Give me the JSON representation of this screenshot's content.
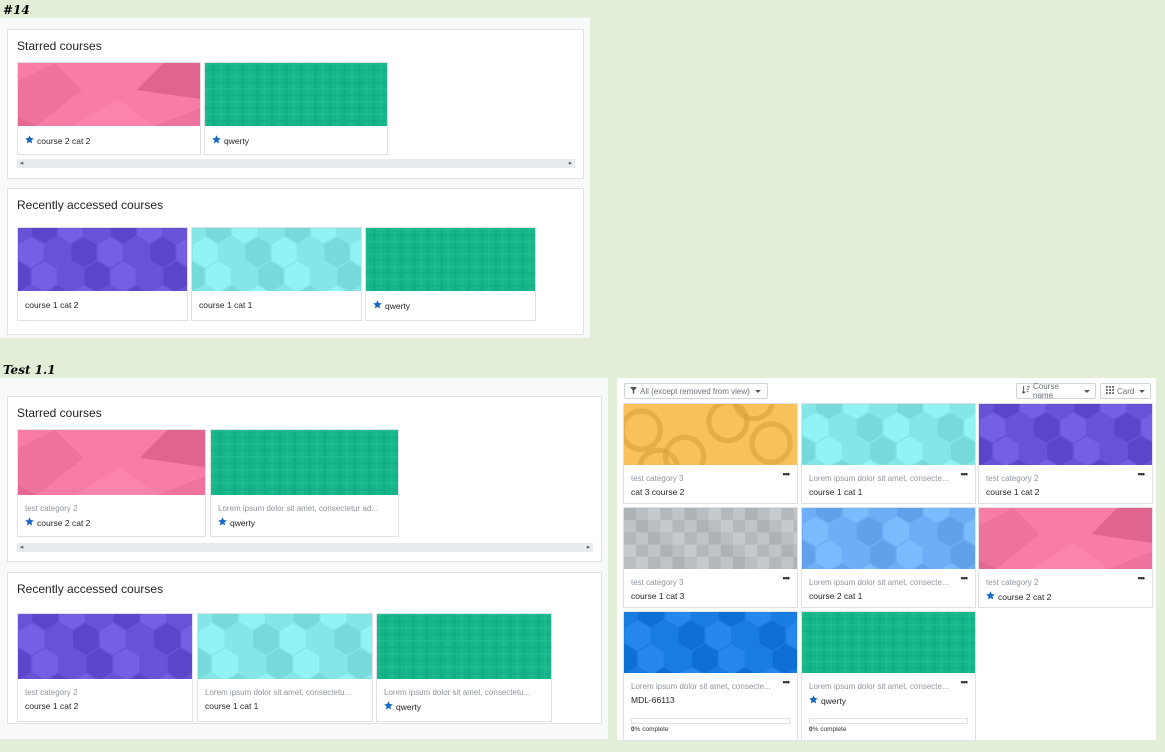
{
  "labels": {
    "section1": "#14",
    "section2": "Test 1.1"
  },
  "colors": {
    "pink": "#f77ca8",
    "green": "#17b58a",
    "purple": "#6a52d6",
    "teal": "#84e6e6",
    "orange": "#f8c15a",
    "grey": "#b8bec2",
    "blue": "#6daef6",
    "darkblue": "#1a7ce0",
    "star": "#1769c3"
  },
  "s14": {
    "starred": {
      "title": "Starred courses",
      "cards": [
        {
          "name": "course 2 cat 2",
          "starred": true,
          "pattern": "pink"
        },
        {
          "name": "qwerty",
          "starred": true,
          "pattern": "green"
        }
      ]
    },
    "recent": {
      "title": "Recently accessed courses",
      "cards": [
        {
          "name": "course 1 cat 2",
          "starred": false,
          "pattern": "purple"
        },
        {
          "name": "course 1 cat 1",
          "starred": false,
          "pattern": "teal"
        },
        {
          "name": "qwerty",
          "starred": true,
          "pattern": "green"
        }
      ]
    }
  },
  "t11": {
    "starred": {
      "title": "Starred courses",
      "cards": [
        {
          "category": "test category 2",
          "name": "course 2 cat 2",
          "starred": true,
          "pattern": "pink"
        },
        {
          "category": "Lorem ipsum dolor sit amet, consectetur ad...",
          "name": "qwerty",
          "starred": true,
          "pattern": "green"
        }
      ]
    },
    "recent": {
      "title": "Recently accessed courses",
      "cards": [
        {
          "category": "test category 2",
          "name": "course 1 cat 2",
          "starred": false,
          "pattern": "purple"
        },
        {
          "category": "Lorem ipsum dolor sit amet, consectetu...",
          "name": "course 1 cat 1",
          "starred": false,
          "pattern": "teal"
        },
        {
          "category": "Lorem ipsum dolor sit amet, consectetu...",
          "name": "qwerty",
          "starred": true,
          "pattern": "green"
        }
      ]
    }
  },
  "overview": {
    "filter_label": "All (except removed from view)",
    "sort_label": "Course name",
    "view_label": "Card",
    "cards": [
      {
        "category": "test category 3",
        "name": "cat 3 course 2",
        "starred": false,
        "pattern": "orange"
      },
      {
        "category": "Lorem ipsum dolor sit amet, consecte...",
        "name": "course 1 cat 1",
        "starred": false,
        "pattern": "teal"
      },
      {
        "category": "test category 2",
        "name": "course 1 cat 2",
        "starred": false,
        "pattern": "purple"
      },
      {
        "category": "test category 3",
        "name": "course 1 cat 3",
        "starred": false,
        "pattern": "grey"
      },
      {
        "category": "Lorem ipsum dolor sit amet, consecte...",
        "name": "course 2 cat 1",
        "starred": false,
        "pattern": "blue"
      },
      {
        "category": "test category 2",
        "name": "course 2 cat 2",
        "starred": true,
        "pattern": "pink"
      },
      {
        "category": "Lorem ipsum dolor sit amet, consecte...",
        "name": "MDL-66113",
        "starred": false,
        "pattern": "darkblue",
        "progress": {
          "percent": "0",
          "suffix": "% complete"
        }
      },
      {
        "category": "Lorem ipsum dolor sit amet, consecte...",
        "name": "qwerty",
        "starred": true,
        "pattern": "green",
        "progress": {
          "percent": "0",
          "suffix": "% complete"
        }
      }
    ]
  }
}
